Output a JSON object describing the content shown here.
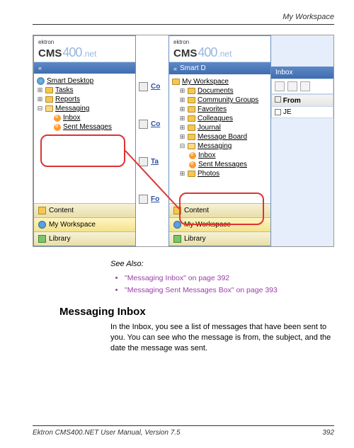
{
  "header": {
    "title": "My Workspace"
  },
  "logo": {
    "brand": "ektron",
    "cms": "CMS",
    "num": "400",
    "net": ".net"
  },
  "left_pane": {
    "barLabel": "",
    "items": [
      {
        "label": "Smart Desktop"
      },
      {
        "label": "Tasks"
      },
      {
        "label": "Reports"
      },
      {
        "label": "Messaging"
      },
      {
        "label": "Inbox"
      },
      {
        "label": "Sent Messages"
      }
    ],
    "tabs": {
      "content": "Content",
      "workspace": "My Workspace",
      "library": "Library"
    }
  },
  "mid": {
    "items": [
      "Co",
      "Co",
      "Ta",
      "Fo"
    ]
  },
  "right_pane": {
    "barLabel": "Smart D",
    "items": [
      {
        "label": "My Workspace"
      },
      {
        "label": "Documents"
      },
      {
        "label": "Community Groups"
      },
      {
        "label": "Favorites"
      },
      {
        "label": "Colleagues"
      },
      {
        "label": "Journal"
      },
      {
        "label": "Message Board"
      },
      {
        "label": "Messaging"
      },
      {
        "label": "Inbox"
      },
      {
        "label": "Sent Messages"
      },
      {
        "label": "Photos"
      }
    ],
    "tabs": {
      "content": "Content",
      "workspace": "My Workspace",
      "library": "Library"
    }
  },
  "inbox": {
    "title": "Inbox",
    "colFrom": "From",
    "row1": "JE"
  },
  "see_also": "See Also:",
  "links": [
    "\"Messaging Inbox\" on page 392",
    "\"Messaging Sent Messages Box\" on page 393"
  ],
  "section_heading": "Messaging Inbox",
  "body": "In the Inbox, you see a list of messages that have been sent to you. You can see who the message is from, the subject, and the date the message was sent.",
  "footer": {
    "left": "Ektron CMS400.NET User Manual, Version 7.5",
    "page": "392"
  }
}
